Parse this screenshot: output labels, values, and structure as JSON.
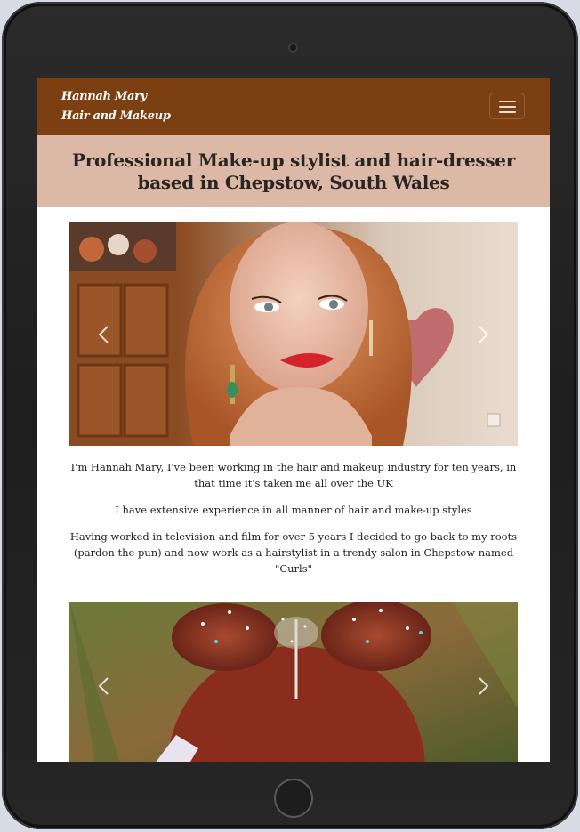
{
  "navbar": {
    "brand_line1": "Hannah Mary",
    "brand_line2": "Hair and Makeup",
    "toggler_icon": "hamburger-icon",
    "background": "#7b3f12"
  },
  "header": {
    "title": "Professional Make-up stylist and hair-dresser based in Chepstow, South Wales",
    "background": "#dcb9a6"
  },
  "carousel_controls": {
    "prev_icon": "chevron-left-icon",
    "next_icon": "chevron-right-icon"
  },
  "intro": {
    "p1": "I'm Hannah Mary, I've been working in the hair and makeup industry for ten years, in that time it's taken me all over the UK",
    "p2": "I have extensive experience in all manner of hair and make-up styles",
    "p3": "Having worked in television and film for over 5 years I decided to go back to my roots (pardon the pun) and now work as a hairstylist in a trendy salon in Chepstow named \"Curls\""
  }
}
